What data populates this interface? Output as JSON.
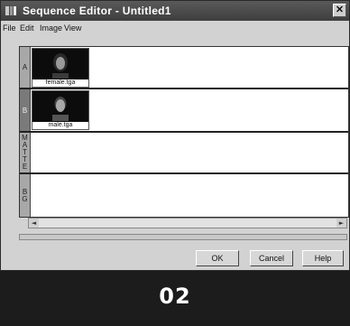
{
  "window": {
    "title": "Sequence Editor - Untitled1",
    "close_glyph": "✕"
  },
  "menu": [
    "File",
    "Edit",
    "Image",
    "View"
  ],
  "tracks": [
    {
      "label": "A",
      "clip": {
        "name": "female.tga",
        "thumb_icon": "female-portrait-icon"
      }
    },
    {
      "label": "B",
      "clip": {
        "name": "male.tga",
        "thumb_icon": "male-portrait-icon"
      }
    },
    {
      "label": "MATTE",
      "clip": null
    },
    {
      "label": "BG",
      "clip": null
    }
  ],
  "buttons": {
    "ok": "OK",
    "cancel": "Cancel",
    "help": "Help"
  },
  "scroll": {
    "left_glyph": "◄",
    "right_glyph": "►"
  },
  "caption": "02",
  "colors": {
    "titlebar": "#4a4a4a",
    "background": "#1c1c1c",
    "window": "#d2d2d2"
  }
}
